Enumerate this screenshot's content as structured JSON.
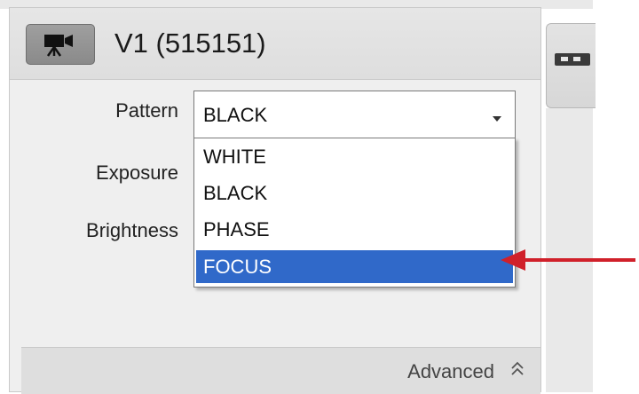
{
  "header": {
    "title": "V1 (515151)",
    "icon": "video-camera-icon"
  },
  "fields": {
    "pattern_label": "Pattern",
    "exposure_label": "Exposure",
    "brightness_label": "Brightness"
  },
  "pattern_select": {
    "value": "BLACK",
    "options": [
      "WHITE",
      "BLACK",
      "PHASE",
      "FOCUS"
    ],
    "highlighted": "FOCUS"
  },
  "advanced": {
    "label": "Advanced",
    "icon": "double-chevron-up-icon"
  },
  "side_tab": {
    "icon": "device-icon"
  },
  "annotation": {
    "icon": "red-arrow-icon",
    "color": "#d0202a"
  },
  "colors": {
    "highlight": "#3069c9",
    "panel_bg": "#efefef"
  }
}
